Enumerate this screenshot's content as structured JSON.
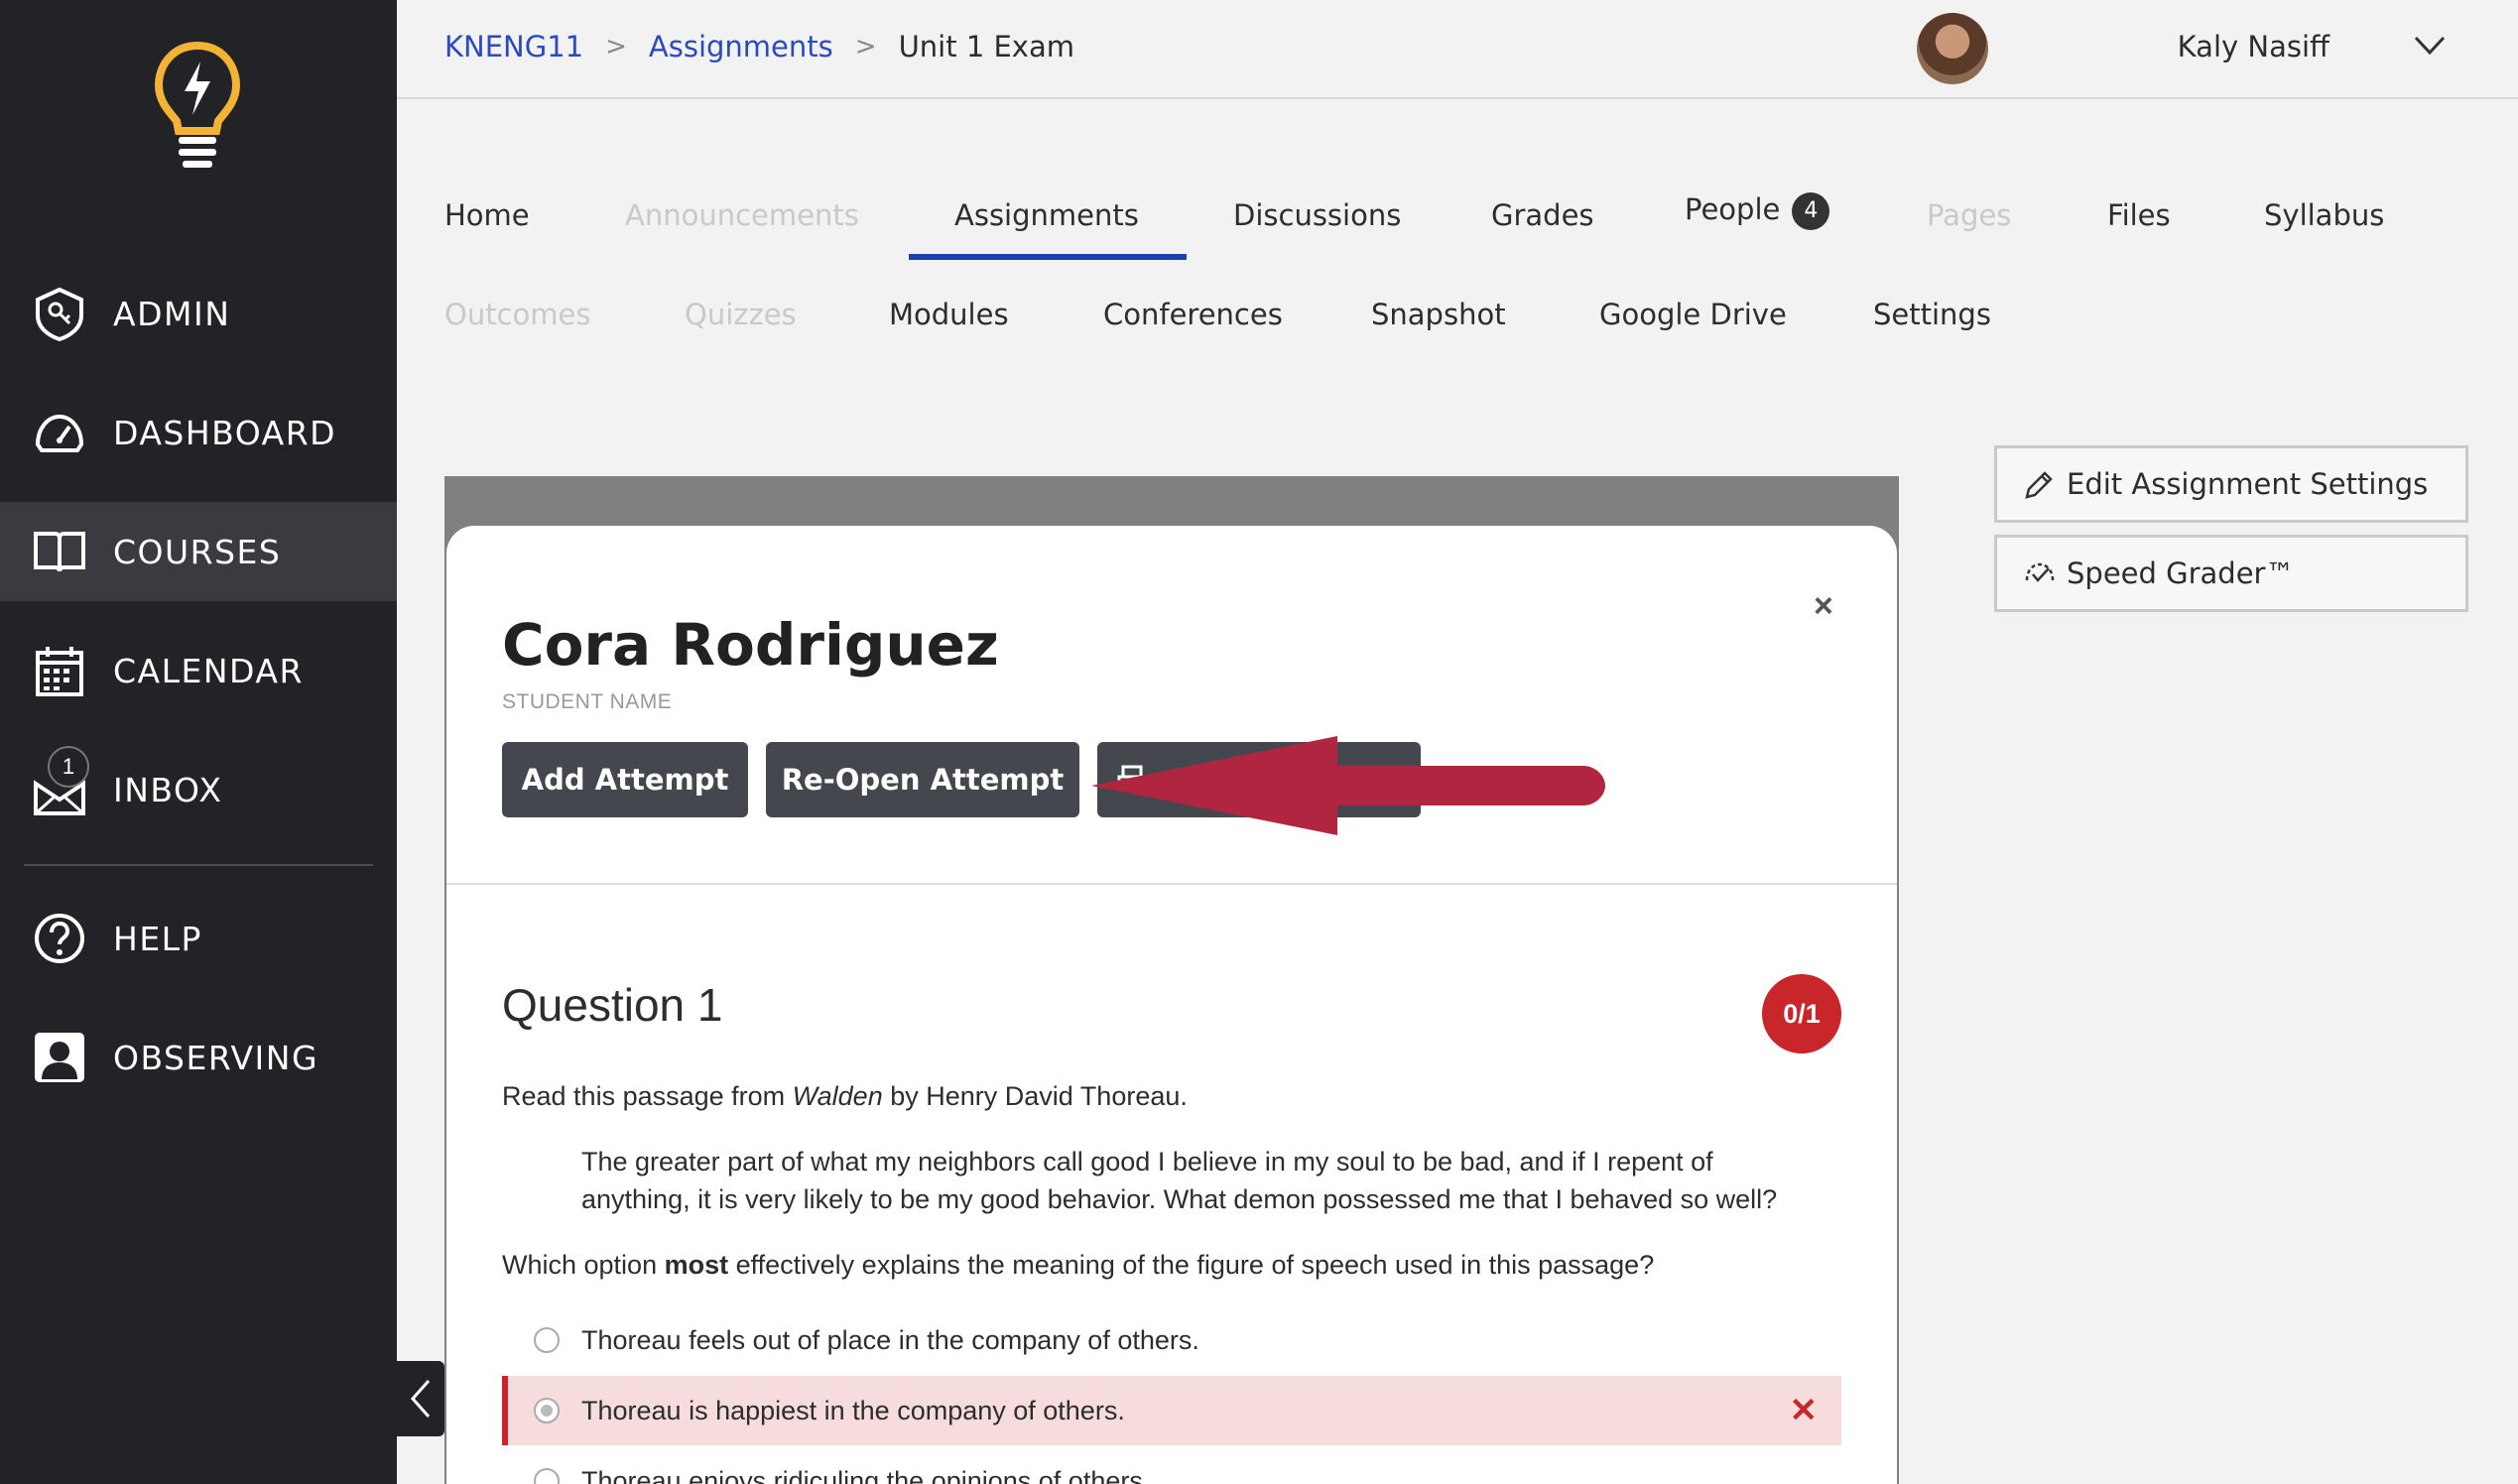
{
  "sidebar": {
    "items": [
      {
        "label": "ADMIN",
        "icon": "shield-key-icon"
      },
      {
        "label": "DASHBOARD",
        "icon": "speedometer-icon"
      },
      {
        "label": "COURSES",
        "icon": "book-icon"
      },
      {
        "label": "CALENDAR",
        "icon": "calendar-icon"
      },
      {
        "label": "INBOX",
        "icon": "inbox-icon",
        "badge": "1"
      },
      {
        "label": "HELP",
        "icon": "help-icon"
      },
      {
        "label": "OBSERVING",
        "icon": "person-icon"
      }
    ],
    "active": "COURSES"
  },
  "header": {
    "breadcrumb": [
      "KNENG11",
      "Assignments",
      "Unit 1 Exam"
    ],
    "user_name": "Kaly Nasiff"
  },
  "tabs": {
    "row1": [
      {
        "label": "Home"
      },
      {
        "label": "Announcements",
        "disabled": true
      },
      {
        "label": "Assignments",
        "active": true
      },
      {
        "label": "Discussions"
      },
      {
        "label": "Grades"
      },
      {
        "label": "People",
        "badge": "4"
      },
      {
        "label": "Pages",
        "disabled": true
      },
      {
        "label": "Files"
      },
      {
        "label": "Syllabus"
      }
    ],
    "row2": [
      {
        "label": "Outcomes",
        "disabled": true
      },
      {
        "label": "Quizzes",
        "disabled": true
      },
      {
        "label": "Modules"
      },
      {
        "label": "Conferences"
      },
      {
        "label": "Snapshot"
      },
      {
        "label": "Google Drive"
      },
      {
        "label": "Settings"
      }
    ]
  },
  "side_buttons": {
    "edit": "Edit Assignment Settings",
    "speed": "Speed Grader™"
  },
  "modal": {
    "close": "×",
    "student_name": "Cora Rodriguez",
    "student_label": "STUDENT NAME",
    "buttons": {
      "add_attempt": "Add Attempt",
      "reopen_attempt": "Re-Open Attempt"
    },
    "question": {
      "title": "Question 1",
      "score": "0/1",
      "intro_pre": "Read this passage from ",
      "intro_italic": "Walden",
      "intro_post": " by Henry David Thoreau.",
      "quote_line1": "The greater part of what my neighbors call good I believe in my soul to be bad, and if I repent of",
      "quote_line2": "anything, it is very likely to be my good behavior. What demon possessed me that I behaved so well?",
      "prompt_pre": "Which option ",
      "prompt_bold": "most",
      "prompt_post": " effectively explains the meaning of the figure of speech used in this passage?",
      "options": [
        {
          "text": "Thoreau feels out of place in the company of others.",
          "selected": false,
          "wrong": false
        },
        {
          "text": "Thoreau is happiest in the company of others.",
          "selected": true,
          "wrong": true
        },
        {
          "text": "Thoreau enjoys ridiculing the opinions of others.",
          "selected": false,
          "wrong": false
        }
      ]
    }
  },
  "colors": {
    "sidebar_bg": "#222327",
    "accent_blue": "#1f3fb5",
    "link_blue": "#2a4ac0",
    "error_red": "#c8262b",
    "arrow_red": "#b02540",
    "logo_yellow": "#f5b335"
  }
}
